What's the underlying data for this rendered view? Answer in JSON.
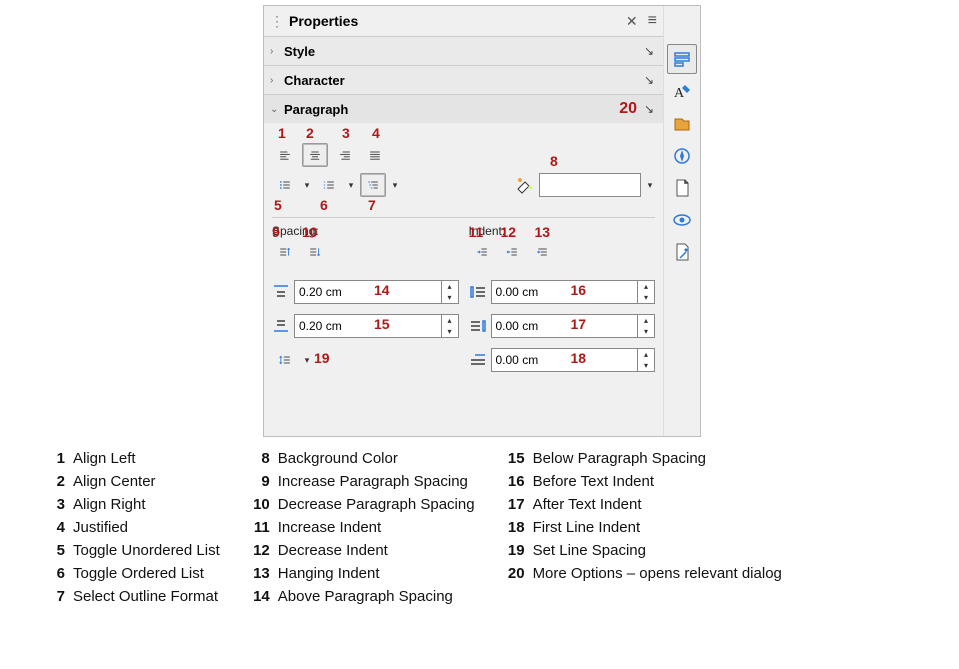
{
  "panel": {
    "title": "Properties",
    "sections": {
      "style": {
        "title": "Style"
      },
      "character": {
        "title": "Character"
      },
      "paragraph": {
        "title": "Paragraph"
      }
    },
    "spacing_label": "Spacing:",
    "indent_label": "Indent:",
    "above_spacing": "0.20 cm",
    "below_spacing": "0.20 cm",
    "before_indent": "0.00 cm",
    "after_indent": "0.00 cm",
    "firstline_indent": "0.00 cm"
  },
  "callouts": {
    "c1": "1",
    "c2": "2",
    "c3": "3",
    "c4": "4",
    "c5": "5",
    "c6": "6",
    "c7": "7",
    "c8": "8",
    "c9": "9",
    "c10": "10",
    "c11": "11",
    "c12": "12",
    "c13": "13",
    "c14": "14",
    "c15": "15",
    "c16": "16",
    "c17": "17",
    "c18": "18",
    "c19": "19",
    "c20": "20"
  },
  "legend": {
    "1": "Align Left",
    "2": "Align Center",
    "3": "Align Right",
    "4": "Justified",
    "5": "Toggle Unordered List",
    "6": "Toggle Ordered List",
    "7": "Select Outline Format",
    "8": "Background Color",
    "9": "Increase Paragraph Spacing",
    "10": "Decrease Paragraph Spacing",
    "11": "Increase Indent",
    "12": "Decrease Indent",
    "13": "Hanging Indent",
    "14": "Above Paragraph Spacing",
    "15": "Below Paragraph Spacing",
    "16": "Before Text Indent",
    "17": "After Text Indent",
    "18": "First Line Indent",
    "19": "Set Line Spacing",
    "20": "More Options – opens relevant dialog"
  }
}
